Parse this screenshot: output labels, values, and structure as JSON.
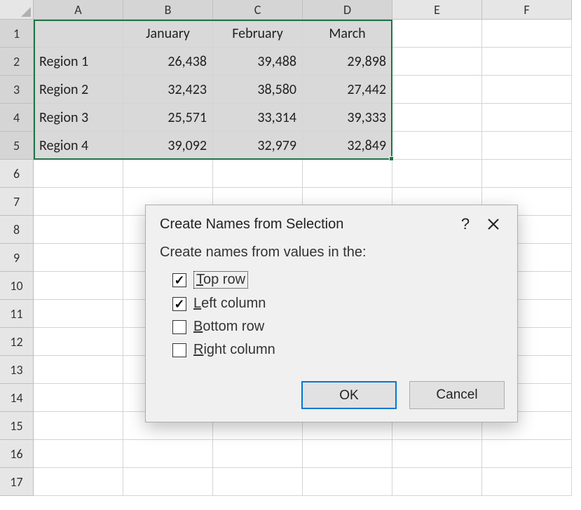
{
  "columns": [
    "A",
    "B",
    "C",
    "D",
    "E",
    "F"
  ],
  "rows": [
    "1",
    "2",
    "3",
    "4",
    "5",
    "6",
    "7",
    "8",
    "9",
    "10",
    "11",
    "12",
    "13",
    "14",
    "15",
    "16",
    "17"
  ],
  "selectedCols": 4,
  "selectedRows": 5,
  "table": {
    "headers": [
      "",
      "January",
      "February",
      "March"
    ],
    "data": [
      {
        "label": "Region 1",
        "values": [
          "26,438",
          "39,488",
          "29,898"
        ]
      },
      {
        "label": "Region 2",
        "values": [
          "32,423",
          "38,580",
          "27,442"
        ]
      },
      {
        "label": "Region 3",
        "values": [
          "25,571",
          "33,314",
          "39,333"
        ]
      },
      {
        "label": "Region 4",
        "values": [
          "39,092",
          "32,979",
          "32,849"
        ]
      }
    ]
  },
  "dialog": {
    "title": "Create Names from Selection",
    "help": "?",
    "instruction": "Create names from values in the:",
    "options": [
      {
        "mn": "T",
        "rest": "op row",
        "checked": true,
        "focused": true,
        "name": "top-row"
      },
      {
        "mn": "L",
        "rest": "eft column",
        "checked": true,
        "focused": false,
        "name": "left-column"
      },
      {
        "mn": "B",
        "rest": "ottom row",
        "checked": false,
        "focused": false,
        "name": "bottom-row"
      },
      {
        "mn": "R",
        "rest": "ight column",
        "checked": false,
        "focused": false,
        "name": "right-column"
      }
    ],
    "ok": "OK",
    "cancel": "Cancel"
  }
}
